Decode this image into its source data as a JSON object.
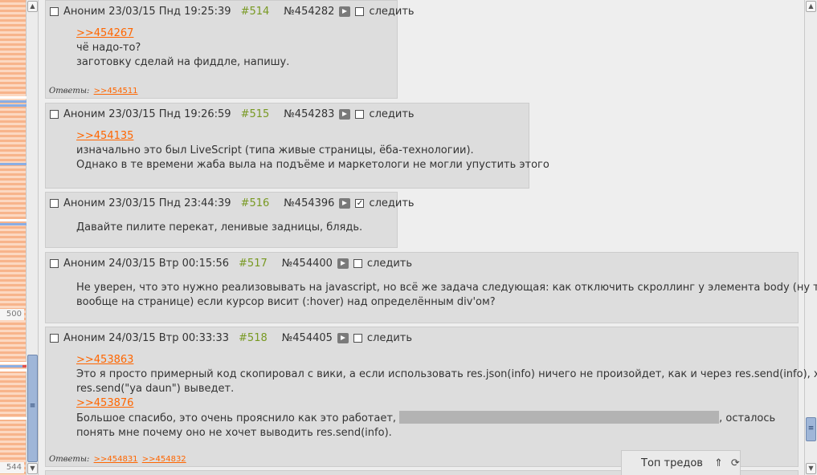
{
  "minimap": {
    "label_500": "500",
    "label_544": "544",
    "marker_colors": {
      "blue": "#8aaee4",
      "red": "#e05050",
      "white": "#ffffff"
    }
  },
  "posts": [
    {
      "author": "Аноним",
      "date": "23/03/15 Пнд 19:25:39",
      "num": "#514",
      "id": "№454282",
      "watch": "следить",
      "watch_checked": false,
      "lines": [
        {
          "type": "ref",
          "text": ">>454267"
        },
        {
          "type": "text",
          "text": "чё надо-то?"
        },
        {
          "type": "text",
          "text": "заготовку сделай на фиддле, напишу."
        }
      ],
      "replies_label": "Ответы:",
      "replies": [
        ">>454511"
      ]
    },
    {
      "author": "Аноним",
      "date": "23/03/15 Пнд 19:26:59",
      "num": "#515",
      "id": "№454283",
      "watch": "следить",
      "watch_checked": false,
      "lines": [
        {
          "type": "ref",
          "text": ">>454135"
        },
        {
          "type": "text",
          "text": "изначально это был LiveScript (типа живые страницы, ёба-технологии)."
        },
        {
          "type": "text",
          "text": "Однако в те времени жаба выла на подъёме и маркетологи не могли упустить этого"
        }
      ]
    },
    {
      "author": "Аноним",
      "date": "23/03/15 Пнд 23:44:39",
      "num": "#516",
      "id": "№454396",
      "watch": "следить",
      "watch_checked": true,
      "lines": [
        {
          "type": "text",
          "text": "Давайте пилите перекат, ленивые задницы, блядь."
        }
      ]
    },
    {
      "author": "Аноним",
      "date": "24/03/15 Втр 00:15:56",
      "num": "#517",
      "id": "№454400",
      "watch": "следить",
      "watch_checked": false,
      "lines": [
        {
          "type": "text",
          "text": "Не уверен, что это нужно реализовывать на javascript, но всё же задача следующая: как отключить скроллинг у элемента body (ну т.е."
        },
        {
          "type": "text",
          "text": "вообще на странице) если курсор висит (:hover) над определённым div'ом?"
        }
      ]
    },
    {
      "author": "Аноним",
      "date": "24/03/15 Втр 00:33:33",
      "num": "#518",
      "id": "№454405",
      "watch": "следить",
      "watch_checked": false,
      "lines": [
        {
          "type": "ref",
          "text": ">>453863"
        },
        {
          "type": "text",
          "text": "Это я просто примерный код скопировал с вики, а если использовать res.json(info) ничего не произойдет, как и через res.send(info), хотя"
        },
        {
          "type": "text",
          "text": "res.send(\"ya daun\") выведет."
        },
        {
          "type": "ref",
          "text": ">>453876"
        },
        {
          "type": "text",
          "text": "Большое спасибо, это очень прояснило как это работает,"
        },
        {
          "type": "text",
          "text": ", осталось"
        },
        {
          "type": "text",
          "text": "понять мне почему оно не хочет выводить res.send(info)."
        }
      ],
      "replies_label": "Ответы:",
      "replies": [
        ">>454831",
        ">>454832"
      ]
    }
  ],
  "top_threads": {
    "label": "Топ тредов",
    "icons": [
      "double-chevron-up-icon",
      "refresh-icon"
    ]
  }
}
